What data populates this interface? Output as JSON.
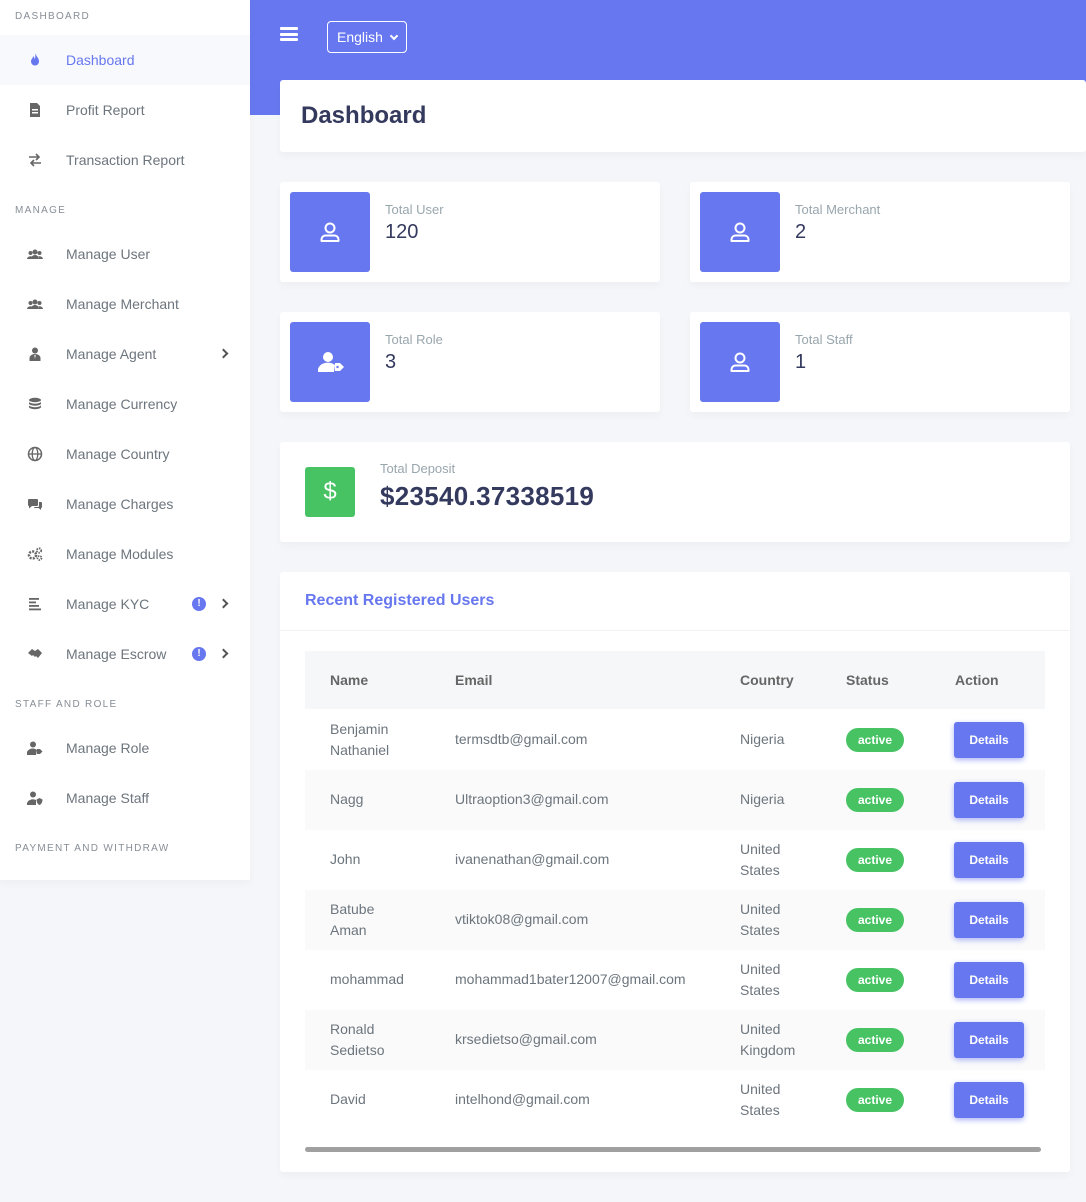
{
  "navbar": {
    "language": "English"
  },
  "sidebar": {
    "sections": {
      "dashboard": "Dashboard",
      "manage": "Manage",
      "staff_and_role": "Staff and role",
      "payment_and_withdraw": "Payment and withdraw"
    },
    "items": {
      "dashboard": "Dashboard",
      "profit_report": "Profit Report",
      "transaction_report": "Transaction Report",
      "manage_user": "Manage User",
      "manage_merchant": "Manage Merchant",
      "manage_agent": "Manage Agent",
      "manage_currency": "Manage Currency",
      "manage_country": "Manage Country",
      "manage_charges": "Manage Charges",
      "manage_modules": "Manage Modules",
      "manage_kyc": "Manage KYC",
      "manage_escrow": "Manage Escrow",
      "manage_role": "Manage Role",
      "manage_staff": "Manage Staff"
    },
    "badge": "!"
  },
  "page": {
    "title": "Dashboard"
  },
  "stats": {
    "total_user": {
      "label": "Total User",
      "value": "120"
    },
    "total_merchant": {
      "label": "Total Merchant",
      "value": "2"
    },
    "total_role": {
      "label": "Total Role",
      "value": "3"
    },
    "total_staff": {
      "label": "Total Staff",
      "value": "1"
    },
    "total_deposit": {
      "label": "Total Deposit",
      "value": "$23540.37338519",
      "icon": "$"
    }
  },
  "recent_users": {
    "title": "Recent Registered Users",
    "columns": {
      "name": "Name",
      "email": "Email",
      "country": "Country",
      "status": "Status",
      "action": "Action"
    },
    "rows": [
      {
        "name1": "Benjamin",
        "name2": "Nathaniel",
        "email": "termsdtb@gmail.com",
        "country1": "Nigeria",
        "country2": "",
        "status": "active",
        "action": "Details"
      },
      {
        "name1": "Nagg",
        "name2": "",
        "email": "Ultraoption3@gmail.com",
        "country1": "Nigeria",
        "country2": "",
        "status": "active",
        "action": "Details"
      },
      {
        "name1": "John",
        "name2": "",
        "email": "ivanenathan@gmail.com",
        "country1": "United",
        "country2": "States",
        "status": "active",
        "action": "Details"
      },
      {
        "name1": "Batube",
        "name2": "Aman",
        "email": "vtiktok08@gmail.com",
        "country1": "United",
        "country2": "States",
        "status": "active",
        "action": "Details"
      },
      {
        "name1": "mohammad",
        "name2": "",
        "email": "mohammad1bater12007@gmail.com",
        "country1": "United",
        "country2": "States",
        "status": "active",
        "action": "Details"
      },
      {
        "name1": "Ronald",
        "name2": "Sedietso",
        "email": "krsedietso@gmail.com",
        "country1": "United",
        "country2": "Kingdom",
        "status": "active",
        "action": "Details"
      },
      {
        "name1": "David",
        "name2": "",
        "email": "intelhond@gmail.com",
        "country1": "United",
        "country2": "States",
        "status": "active",
        "action": "Details"
      }
    ]
  },
  "colors": {
    "primary": "#6777ef",
    "success": "#47c363",
    "background": "#f4f6f9"
  }
}
